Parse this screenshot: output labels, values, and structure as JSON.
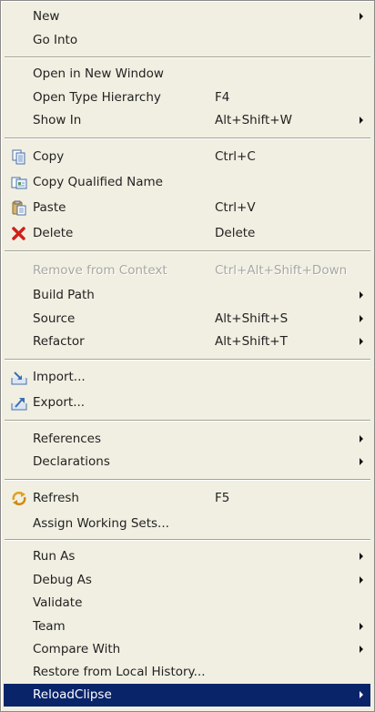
{
  "menu": {
    "new": {
      "label": "New"
    },
    "go_into": {
      "label": "Go Into"
    },
    "open_new_window": {
      "label": "Open in New Window"
    },
    "open_type_hierarchy": {
      "label": "Open Type Hierarchy",
      "shortcut": "F4"
    },
    "show_in": {
      "label": "Show In",
      "shortcut": "Alt+Shift+W"
    },
    "copy": {
      "label": "Copy",
      "shortcut": "Ctrl+C",
      "icon": "copy-icon"
    },
    "copy_qualified_name": {
      "label": "Copy Qualified Name",
      "icon": "copy-qualified-name-icon"
    },
    "paste": {
      "label": "Paste",
      "shortcut": "Ctrl+V",
      "icon": "paste-icon"
    },
    "delete": {
      "label": "Delete",
      "shortcut": "Delete",
      "icon": "delete-icon"
    },
    "remove_from_context": {
      "label": "Remove from Context",
      "shortcut": "Ctrl+Alt+Shift+Down"
    },
    "build_path": {
      "label": "Build Path"
    },
    "source": {
      "label": "Source",
      "shortcut": "Alt+Shift+S"
    },
    "refactor": {
      "label": "Refactor",
      "shortcut": "Alt+Shift+T"
    },
    "import": {
      "label": "Import...",
      "icon": "import-icon"
    },
    "export": {
      "label": "Export...",
      "icon": "export-icon"
    },
    "references": {
      "label": "References"
    },
    "declarations": {
      "label": "Declarations"
    },
    "refresh": {
      "label": "Refresh",
      "shortcut": "F5",
      "icon": "refresh-icon"
    },
    "assign_working_sets": {
      "label": "Assign Working Sets..."
    },
    "run_as": {
      "label": "Run As"
    },
    "debug_as": {
      "label": "Debug As"
    },
    "validate": {
      "label": "Validate"
    },
    "team": {
      "label": "Team"
    },
    "compare_with": {
      "label": "Compare With"
    },
    "restore_local_history": {
      "label": "Restore from Local History..."
    },
    "reloadclipse": {
      "label": "ReloadClipse"
    }
  },
  "colors": {
    "menu_background": "#f1efe2",
    "selection": "#0a246a",
    "disabled_text": "#a8a8a0"
  }
}
